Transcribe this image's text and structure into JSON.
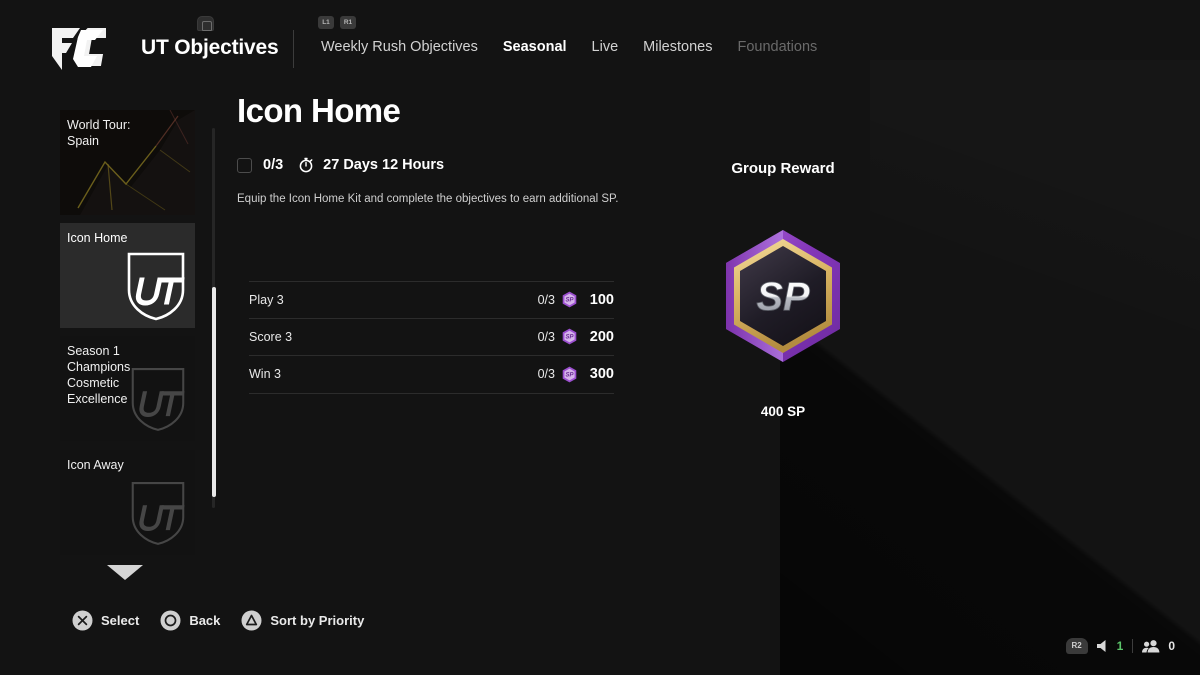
{
  "header": {
    "logo_icon": "ea-fc-logo",
    "lock_icon": "lock-badge-icon",
    "title": "UT Objectives",
    "shoulder_buttons": [
      "L1",
      "R1"
    ],
    "tabs": [
      {
        "label": "Weekly Rush Objectives",
        "state": "normal"
      },
      {
        "label": "Seasonal",
        "state": "active"
      },
      {
        "label": "Live",
        "state": "normal"
      },
      {
        "label": "Milestones",
        "state": "normal"
      },
      {
        "label": "Foundations",
        "state": "dim"
      }
    ]
  },
  "sidebar": {
    "items": [
      {
        "label": "World Tour:\nSpain",
        "selected": false,
        "art": "spain-artwork",
        "shield": false
      },
      {
        "label": "Icon Home",
        "selected": true,
        "shield": true
      },
      {
        "label": "Season 1\nChampions\nCosmetic\nExcellence",
        "selected": false,
        "shield": true
      },
      {
        "label": "Icon Away",
        "selected": false,
        "shield": true
      }
    ],
    "scroll_down_icon": "chevron-down-icon"
  },
  "main": {
    "title": "Icon Home",
    "progress": "0/3",
    "timer_icon": "stopwatch-icon",
    "time_remaining": "27 Days 12 Hours",
    "description": "Equip the Icon Home Kit and complete the objectives to earn additional SP.",
    "objectives": [
      {
        "name": "Play 3",
        "progress": "0/3",
        "currency_icon": "sp-token-icon",
        "amount": "100"
      },
      {
        "name": "Score 3",
        "progress": "0/3",
        "currency_icon": "sp-token-icon",
        "amount": "200"
      },
      {
        "name": "Win 3",
        "progress": "0/3",
        "currency_icon": "sp-token-icon",
        "amount": "300"
      }
    ]
  },
  "reward": {
    "title": "Group Reward",
    "badge_label": "SP",
    "badge_colors": {
      "outer": "#8b3fc4",
      "mid": "#b57ae0",
      "gold": "#e8c879",
      "inner": "#2a2730"
    },
    "amount": "400 SP"
  },
  "footer": {
    "actions": [
      {
        "button": "cross-button",
        "label": "Select"
      },
      {
        "button": "circle-button",
        "label": "Back"
      },
      {
        "button": "triangle-button",
        "label": "Sort by Priority"
      }
    ]
  },
  "status_bar": {
    "trigger_key": "R2",
    "speaker_icon": "speaker-icon",
    "speaker_count": "1",
    "people_icon": "people-icon",
    "people_count": "0",
    "accent_green": "#5bc46a"
  }
}
